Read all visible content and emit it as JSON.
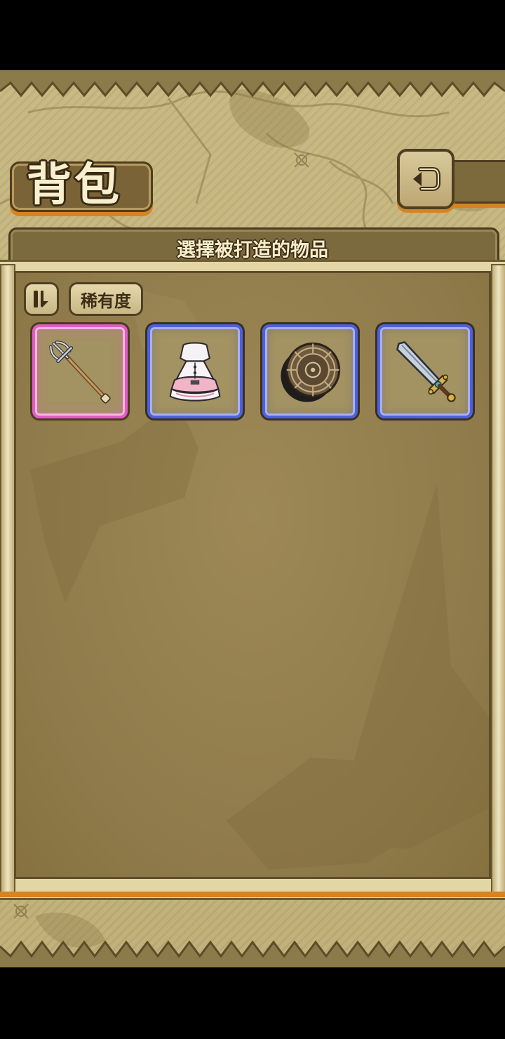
{
  "header": {
    "title": "背包",
    "back_icon": "return-arrow-icon"
  },
  "panel": {
    "subtitle": "選擇被打造的物品"
  },
  "filter": {
    "sort_icon": "sort-toggle-icon",
    "rarity_label": "稀有度"
  },
  "items": [
    {
      "icon": "trident-icon",
      "rarity_color": "#e05dc3"
    },
    {
      "icon": "pink-dress-icon",
      "rarity_color": "#4d61e0"
    },
    {
      "icon": "compass-disc-icon",
      "rarity_color": "#4d61e0"
    },
    {
      "icon": "sword-icon",
      "rarity_color": "#4d61e0"
    }
  ],
  "colors": {
    "accent_orange": "#d7831f",
    "parchment": "#c9b983",
    "panel_bg": "#8f7a4b"
  }
}
